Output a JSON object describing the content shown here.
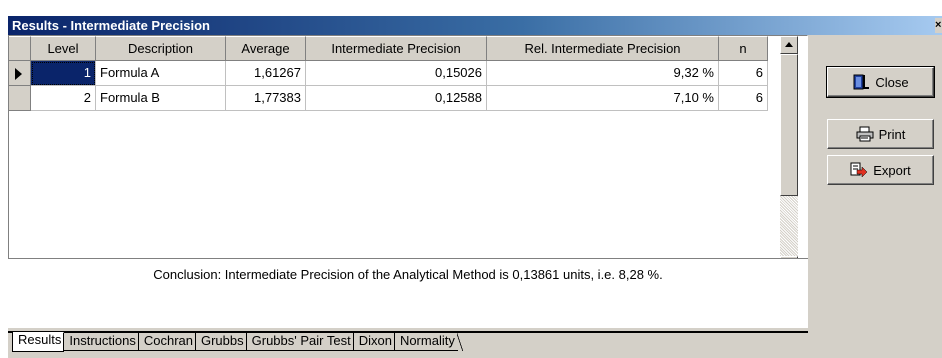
{
  "window": {
    "title": "Results - Intermediate Precision",
    "close_glyph": "×"
  },
  "grid": {
    "columns": [
      "Level",
      "Description",
      "Average",
      "Intermediate Precision",
      "Rel. Intermediate Precision",
      "n"
    ],
    "rows": [
      {
        "level": "1",
        "description": "Formula A",
        "average": "1,61267",
        "ip": "0,15026",
        "rip": "9,32 %",
        "n": "6",
        "selected": true
      },
      {
        "level": "2",
        "description": "Formula B",
        "average": "1,77383",
        "ip": "0,12588",
        "rip": "7,10 %",
        "n": "6",
        "selected": false
      }
    ]
  },
  "conclusion": "Conclusion: Intermediate Precision of the Analytical Method is 0,13861 units, i.e. 8,28 %.",
  "tabs": [
    "Results",
    "Instructions",
    "Cochran",
    "Grubbs",
    "Grubbs' Pair Test",
    "Dixon",
    "Normality"
  ],
  "active_tab": "Results",
  "buttons": {
    "close": "Close",
    "print": "Print",
    "export": "Export"
  },
  "icons": [
    "door-exit-icon",
    "printer-icon",
    "export-arrow-icon"
  ],
  "colors": {
    "title_start": "#0a246a",
    "title_end": "#a6caf0",
    "face": "#d4d0c8",
    "selection": "#0a246a",
    "export_arrow": "#e03020"
  }
}
